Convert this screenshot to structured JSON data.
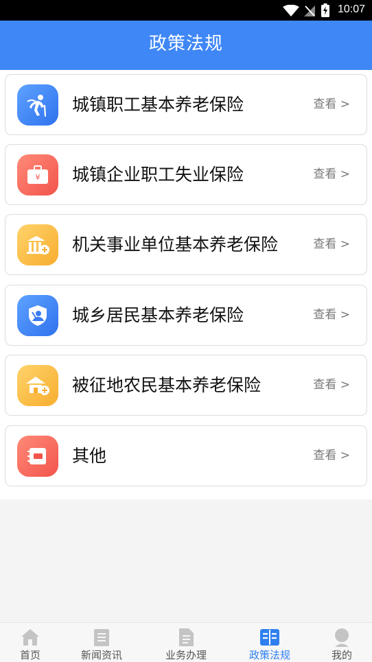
{
  "status_bar": {
    "time": "10:07"
  },
  "header": {
    "title": "政策法规"
  },
  "policies": [
    {
      "label": "城镇职工基本养老保险",
      "action": "查看 >",
      "icon": "elderly-walking-icon",
      "color": "blue"
    },
    {
      "label": "城镇企业职工失业保险",
      "action": "查看 >",
      "icon": "briefcase-yuan-icon",
      "color": "red"
    },
    {
      "label": "机关事业单位基本养老保险",
      "action": "查看 >",
      "icon": "government-building-icon",
      "color": "yellow"
    },
    {
      "label": "城乡居民基本养老保险",
      "action": "查看 >",
      "icon": "shield-person-icon",
      "color": "blue"
    },
    {
      "label": "被征地农民基本养老保险",
      "action": "查看 >",
      "icon": "farmhouse-icon",
      "color": "yellow"
    },
    {
      "label": "其他",
      "action": "查看 >",
      "icon": "notebook-icon",
      "color": "red"
    }
  ],
  "nav": [
    {
      "label": "首页",
      "icon": "home-icon",
      "active": false
    },
    {
      "label": "新闻资讯",
      "icon": "news-icon",
      "active": false
    },
    {
      "label": "业务办理",
      "icon": "document-icon",
      "active": false
    },
    {
      "label": "政策法规",
      "icon": "policy-book-icon",
      "active": true
    },
    {
      "label": "我的",
      "icon": "user-icon",
      "active": false
    }
  ]
}
